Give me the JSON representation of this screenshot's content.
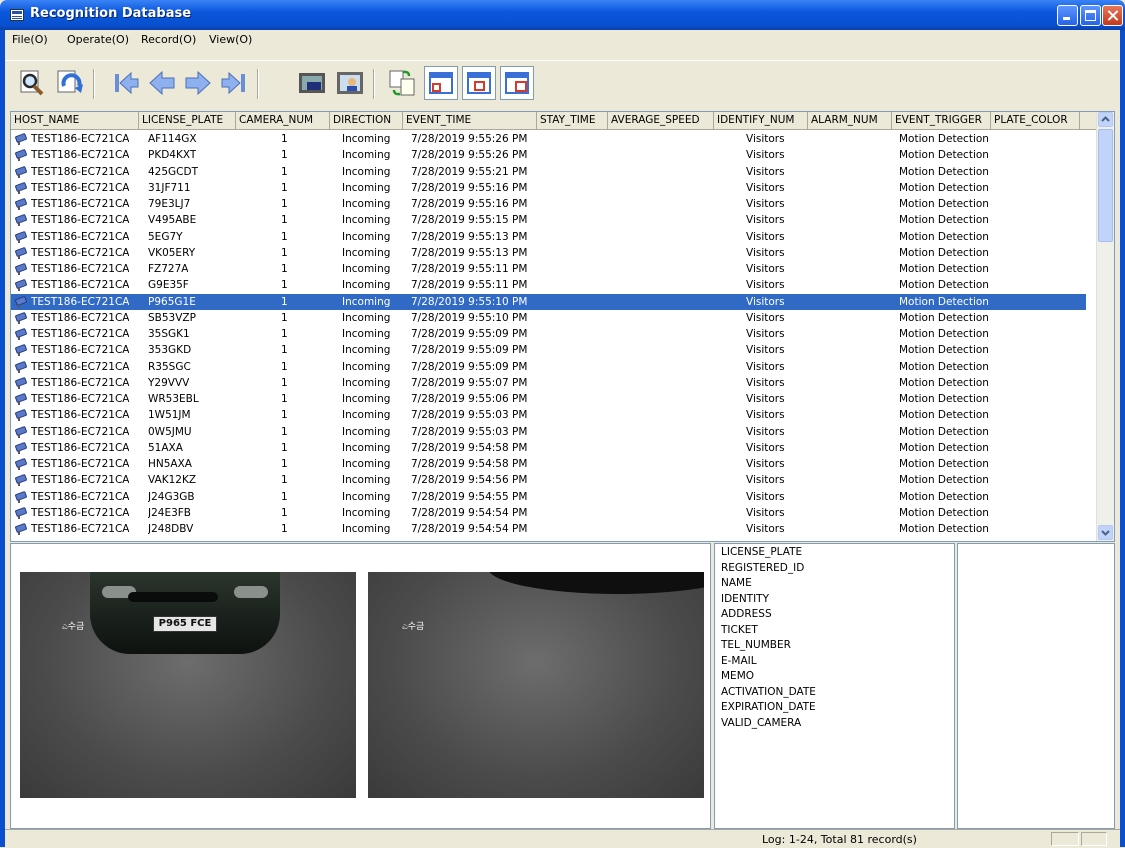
{
  "window": {
    "title": "Recognition Database"
  },
  "menu": [
    "File(O)",
    "Operate(O)",
    "Record(O)",
    "View(O)"
  ],
  "toolbar_icons": [
    "search-icon",
    "refresh-icon",
    "first-record-icon",
    "previous-record-icon",
    "next-record-icon",
    "last-record-icon",
    "video-icon",
    "photo-person-icon",
    "export-icon",
    "layout-one-icon",
    "layout-two-icon",
    "layout-three-icon"
  ],
  "table": {
    "columns": [
      "HOST_NAME",
      "LICENSE_PLATE",
      "CAMERA_NUM",
      "DIRECTION",
      "EVENT_TIME",
      "STAY_TIME",
      "AVERAGE_SPEED",
      "IDENTIFY_NUM",
      "ALARM_NUM",
      "EVENT_TRIGGER",
      "PLATE_COLOR"
    ],
    "selected_index": 10,
    "rows": [
      [
        "TEST186-EC721CA",
        "AF114GX",
        "1",
        "Incoming",
        "7/28/2019 9:55:26 PM",
        "",
        "",
        "Visitors",
        "",
        "Motion Detection",
        ""
      ],
      [
        "TEST186-EC721CA",
        "PKD4KXT",
        "1",
        "Incoming",
        "7/28/2019 9:55:26 PM",
        "",
        "",
        "Visitors",
        "",
        "Motion Detection",
        ""
      ],
      [
        "TEST186-EC721CA",
        "425GCDT",
        "1",
        "Incoming",
        "7/28/2019 9:55:21 PM",
        "",
        "",
        "Visitors",
        "",
        "Motion Detection",
        ""
      ],
      [
        "TEST186-EC721CA",
        "31JF711",
        "1",
        "Incoming",
        "7/28/2019 9:55:16 PM",
        "",
        "",
        "Visitors",
        "",
        "Motion Detection",
        ""
      ],
      [
        "TEST186-EC721CA",
        "79E3LJ7",
        "1",
        "Incoming",
        "7/28/2019 9:55:16 PM",
        "",
        "",
        "Visitors",
        "",
        "Motion Detection",
        ""
      ],
      [
        "TEST186-EC721CA",
        "V495ABE",
        "1",
        "Incoming",
        "7/28/2019 9:55:15 PM",
        "",
        "",
        "Visitors",
        "",
        "Motion Detection",
        ""
      ],
      [
        "TEST186-EC721CA",
        "5EG7Y",
        "1",
        "Incoming",
        "7/28/2019 9:55:13 PM",
        "",
        "",
        "Visitors",
        "",
        "Motion Detection",
        ""
      ],
      [
        "TEST186-EC721CA",
        "VK05ERY",
        "1",
        "Incoming",
        "7/28/2019 9:55:13 PM",
        "",
        "",
        "Visitors",
        "",
        "Motion Detection",
        ""
      ],
      [
        "TEST186-EC721CA",
        "FZ727A",
        "1",
        "Incoming",
        "7/28/2019 9:55:11 PM",
        "",
        "",
        "Visitors",
        "",
        "Motion Detection",
        ""
      ],
      [
        "TEST186-EC721CA",
        "G9E35F",
        "1",
        "Incoming",
        "7/28/2019 9:55:11 PM",
        "",
        "",
        "Visitors",
        "",
        "Motion Detection",
        ""
      ],
      [
        "TEST186-EC721CA",
        "P965G1E",
        "1",
        "Incoming",
        "7/28/2019 9:55:10 PM",
        "",
        "",
        "Visitors",
        "",
        "Motion Detection",
        ""
      ],
      [
        "TEST186-EC721CA",
        "SB53VZP",
        "1",
        "Incoming",
        "7/28/2019 9:55:10 PM",
        "",
        "",
        "Visitors",
        "",
        "Motion Detection",
        ""
      ],
      [
        "TEST186-EC721CA",
        "35SGK1",
        "1",
        "Incoming",
        "7/28/2019 9:55:09 PM",
        "",
        "",
        "Visitors",
        "",
        "Motion Detection",
        ""
      ],
      [
        "TEST186-EC721CA",
        "353GKD",
        "1",
        "Incoming",
        "7/28/2019 9:55:09 PM",
        "",
        "",
        "Visitors",
        "",
        "Motion Detection",
        ""
      ],
      [
        "TEST186-EC721CA",
        "R35SGC",
        "1",
        "Incoming",
        "7/28/2019 9:55:09 PM",
        "",
        "",
        "Visitors",
        "",
        "Motion Detection",
        ""
      ],
      [
        "TEST186-EC721CA",
        "Y29VVV",
        "1",
        "Incoming",
        "7/28/2019 9:55:07 PM",
        "",
        "",
        "Visitors",
        "",
        "Motion Detection",
        ""
      ],
      [
        "TEST186-EC721CA",
        "WR53EBL",
        "1",
        "Incoming",
        "7/28/2019 9:55:06 PM",
        "",
        "",
        "Visitors",
        "",
        "Motion Detection",
        ""
      ],
      [
        "TEST186-EC721CA",
        "1W51JM",
        "1",
        "Incoming",
        "7/28/2019 9:55:03 PM",
        "",
        "",
        "Visitors",
        "",
        "Motion Detection",
        ""
      ],
      [
        "TEST186-EC721CA",
        "0W5JMU",
        "1",
        "Incoming",
        "7/28/2019 9:55:03 PM",
        "",
        "",
        "Visitors",
        "",
        "Motion Detection",
        ""
      ],
      [
        "TEST186-EC721CA",
        "51AXA",
        "1",
        "Incoming",
        "7/28/2019 9:54:58 PM",
        "",
        "",
        "Visitors",
        "",
        "Motion Detection",
        ""
      ],
      [
        "TEST186-EC721CA",
        "HN5AXA",
        "1",
        "Incoming",
        "7/28/2019 9:54:58 PM",
        "",
        "",
        "Visitors",
        "",
        "Motion Detection",
        ""
      ],
      [
        "TEST186-EC721CA",
        "VAK12KZ",
        "1",
        "Incoming",
        "7/28/2019 9:54:56 PM",
        "",
        "",
        "Visitors",
        "",
        "Motion Detection",
        ""
      ],
      [
        "TEST186-EC721CA",
        "J24G3GB",
        "1",
        "Incoming",
        "7/28/2019 9:54:55 PM",
        "",
        "",
        "Visitors",
        "",
        "Motion Detection",
        ""
      ],
      [
        "TEST186-EC721CA",
        "J24E3FB",
        "1",
        "Incoming",
        "7/28/2019 9:54:54 PM",
        "",
        "",
        "Visitors",
        "",
        "Motion Detection",
        ""
      ],
      [
        "TEST186-EC721CA",
        "J248DBV",
        "1",
        "Incoming",
        "7/28/2019 9:54:54 PM",
        "",
        "",
        "Visitors",
        "",
        "Motion Detection",
        ""
      ]
    ]
  },
  "images": {
    "plate_text": "P965 FCE",
    "osd_text": "ಎ수금"
  },
  "info_fields": [
    "LICENSE_PLATE",
    "REGISTERED_ID",
    "NAME",
    "IDENTITY",
    "ADDRESS",
    "TICKET",
    "TEL_NUMBER",
    "E-MAIL",
    "MEMO",
    "ACTIVATION_DATE",
    "EXPIRATION_DATE",
    "VALID_CAMERA"
  ],
  "status": {
    "log_text": "Log: 1-24, Total 81 record(s)"
  },
  "colors": {
    "selection": "#316ac5",
    "titlebar": "#0a57dc",
    "face": "#ece9d8"
  }
}
